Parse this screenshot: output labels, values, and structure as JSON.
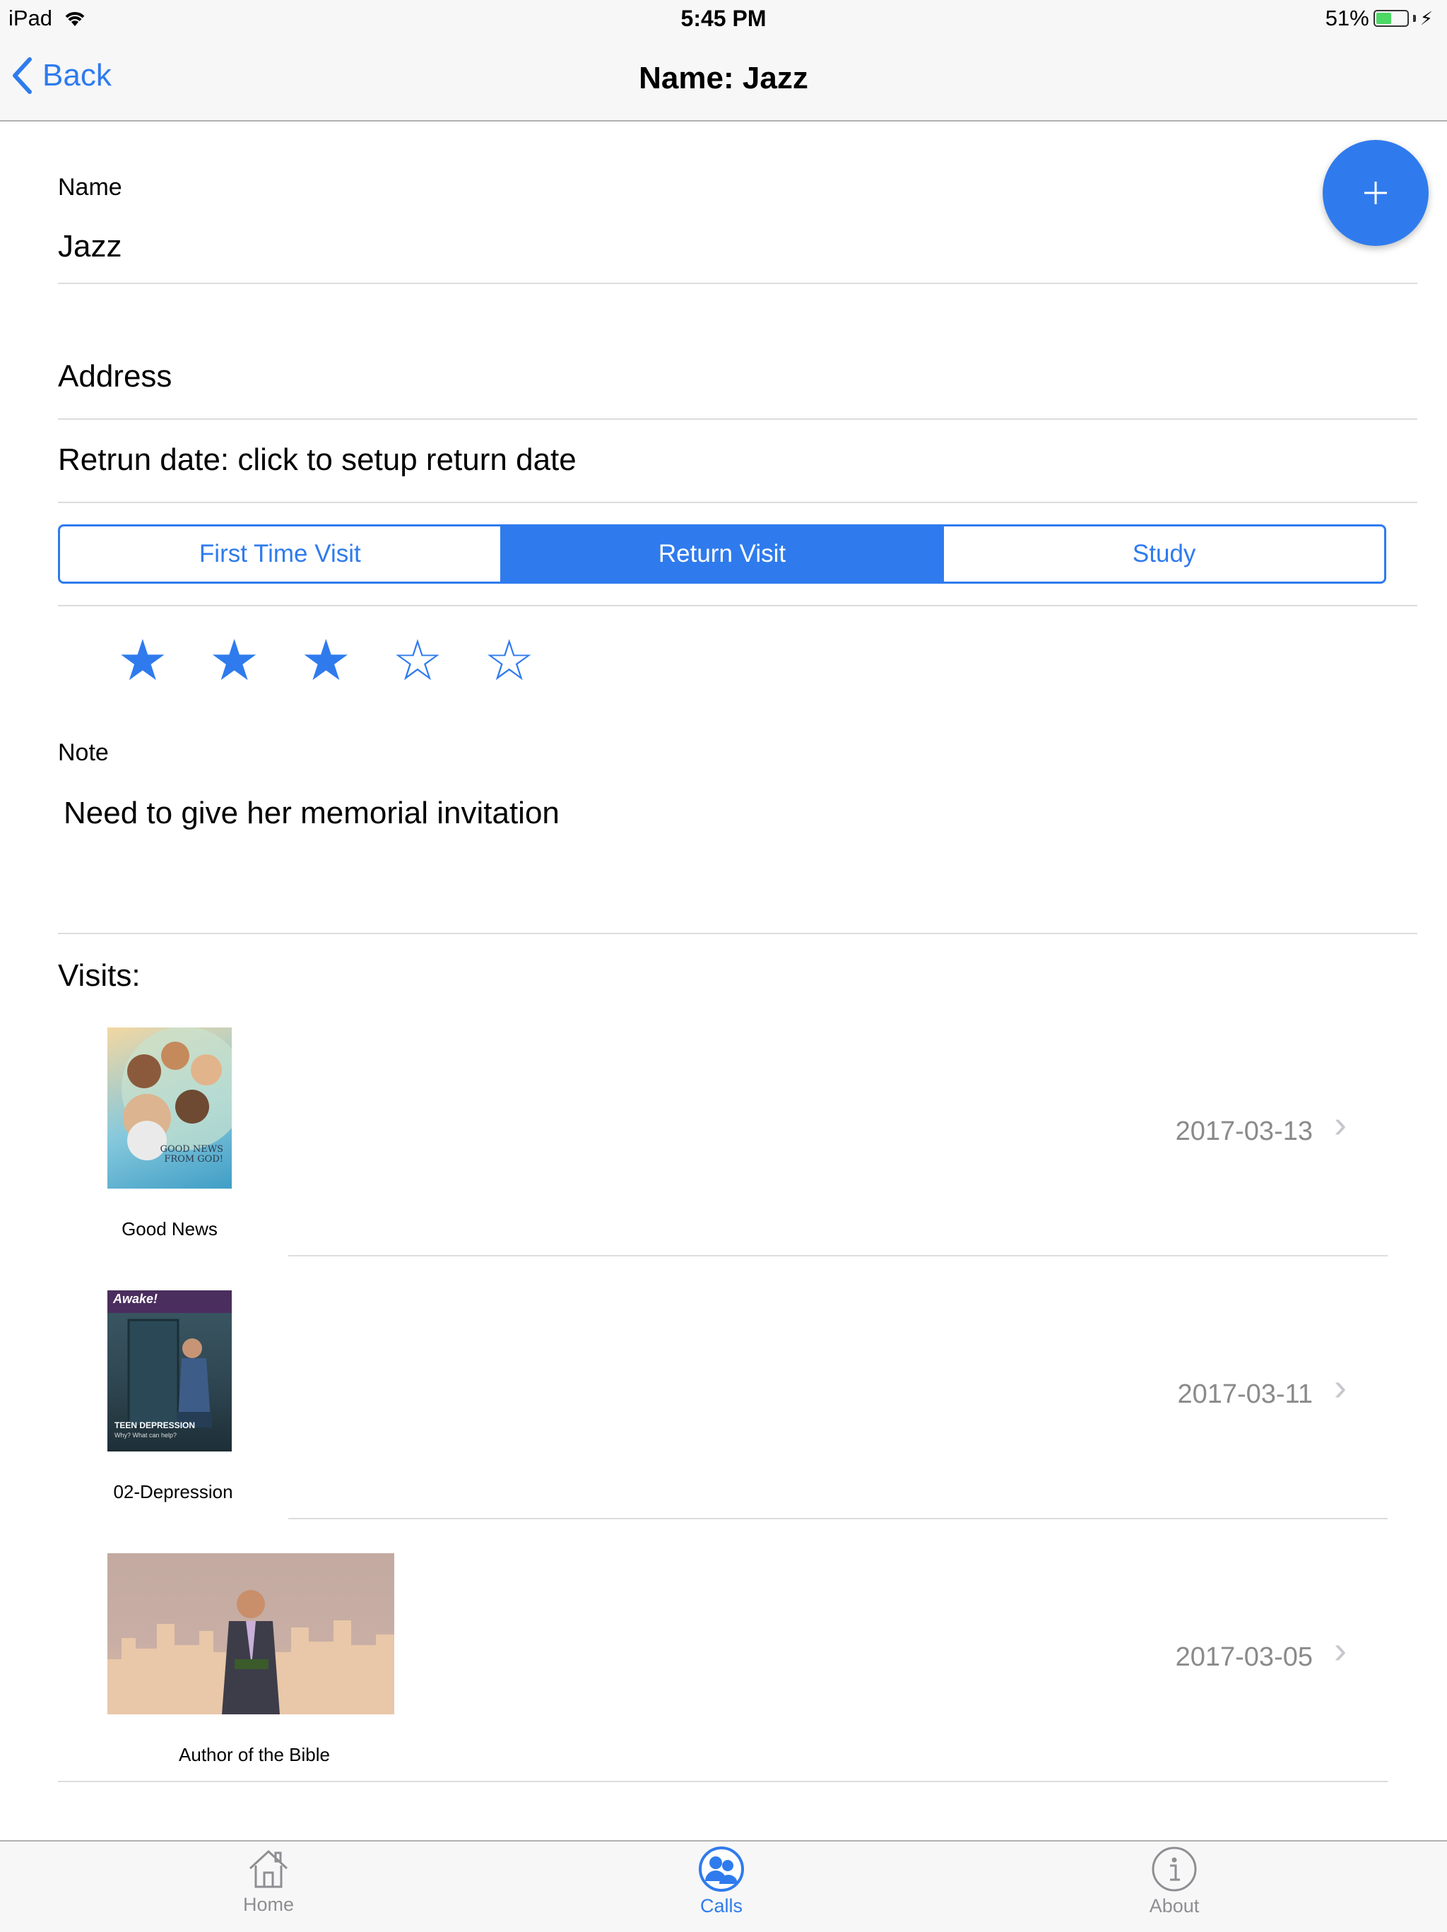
{
  "status_bar": {
    "device": "iPad",
    "time": "5:45 PM",
    "battery": "51%",
    "battery_level": 0.51
  },
  "nav": {
    "back_label": "Back",
    "title": "Name: Jazz"
  },
  "form": {
    "name_label": "Name",
    "name_value": "Jazz",
    "address_label": "Address",
    "return_date": "Retrun date: click to setup return date",
    "segments": [
      "First Time Visit",
      "Return Visit",
      "Study"
    ],
    "selected_segment": "Return Visit",
    "rating": 3,
    "rating_max": 5,
    "note_label": "Note",
    "note_value": "Need to give her memorial invitation"
  },
  "visits": {
    "heading": "Visits:",
    "items": [
      {
        "label": "Good News",
        "date": "2017-03-13",
        "cover_text": "GOOD NEWS FROM GOD!"
      },
      {
        "label": "02-Depression",
        "date": "2017-03-11",
        "cover_brand": "Awake!",
        "cover_text": "TEEN DEPRESSION",
        "cover_subtext": "Why? What can help?"
      },
      {
        "label": "Author of the Bible",
        "date": "2017-03-05"
      }
    ]
  },
  "tab_bar": {
    "items": [
      {
        "label": "Home",
        "icon": "home-icon"
      },
      {
        "label": "Calls",
        "icon": "calls-icon",
        "active": true
      },
      {
        "label": "About",
        "icon": "info-icon"
      }
    ]
  },
  "colors": {
    "accent": "#2f7bed",
    "battery": "#4cd964",
    "secondary_text": "#8a8a8a",
    "inactive_tab": "#8e8e93"
  }
}
